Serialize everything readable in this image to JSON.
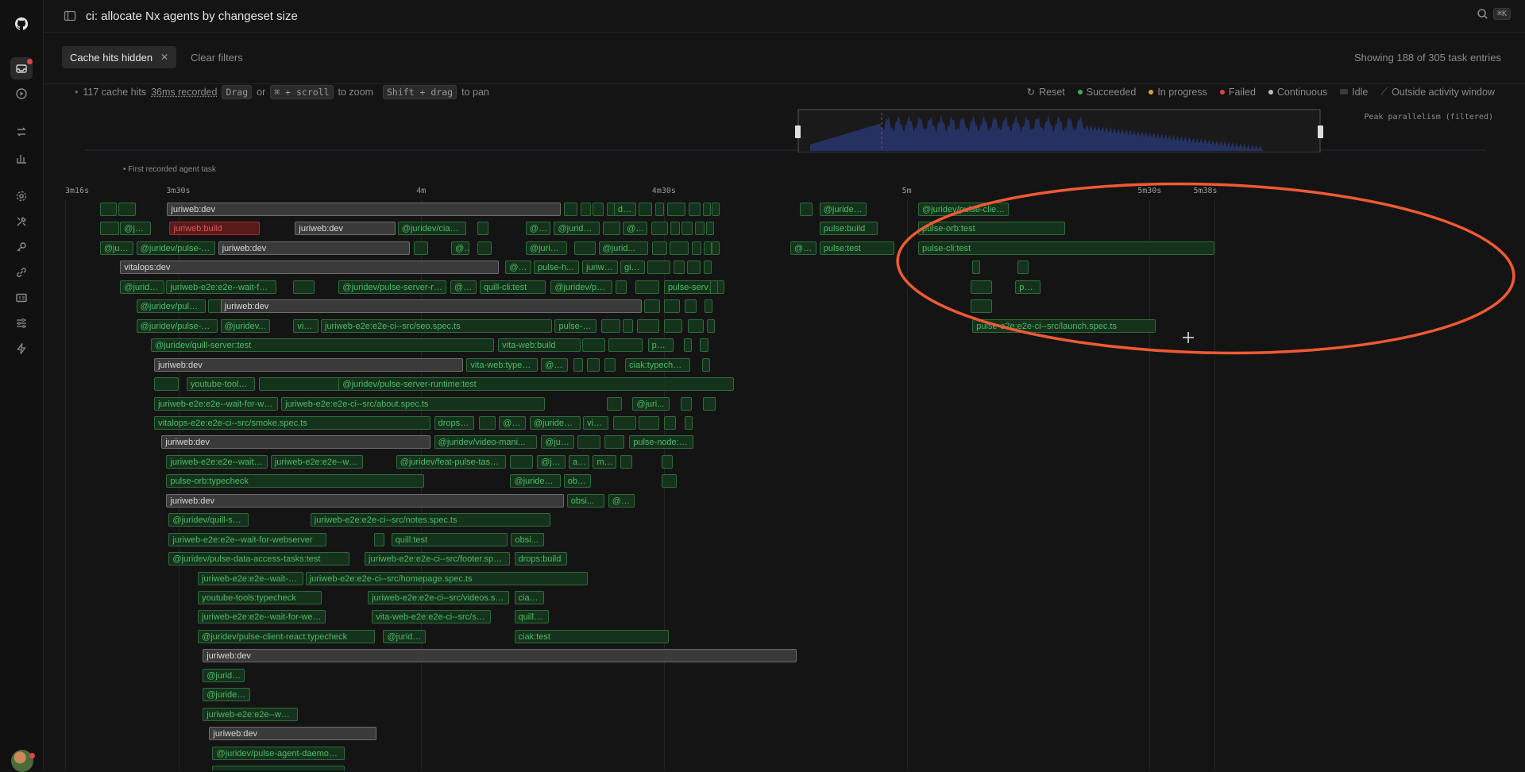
{
  "window": {
    "title": "ci: allocate Nx agents by changeset size",
    "search_shortcut": "⌘K"
  },
  "filters": {
    "chip_label": "Cache hits hidden",
    "clear_label": "Clear filters",
    "showing": "Showing 188 of 305 task entries"
  },
  "hint": {
    "cache_hits": "117 cache hits",
    "recorded": "36ms recorded",
    "drag": "Drag",
    "or": "or",
    "zoom_keys": "⌘ + scroll",
    "to_zoom": "to zoom",
    "pan_keys": "Shift + drag",
    "to_pan": "to pan"
  },
  "legend": {
    "reset": "Reset",
    "succeeded": "Succeeded",
    "in_progress": "In progress",
    "failed": "Failed",
    "continuous": "Continuous",
    "idle": "Idle",
    "outside": "Outside activity window",
    "colors": {
      "succeeded": "#3fae5a",
      "in_progress": "#d9a531",
      "failed": "#e0434b",
      "continuous": "#bdbdbd",
      "idle": "#3a3a3a"
    }
  },
  "minimap": {
    "peak_label": "Peak parallelism (filtered)"
  },
  "first_task_label": "• First recorded agent task",
  "axis": {
    "ticks": [
      {
        "label": "3m16s",
        "t": 196
      },
      {
        "label": "3m30s",
        "t": 210
      },
      {
        "label": "4m",
        "t": 240
      },
      {
        "label": "4m30s",
        "t": 270
      },
      {
        "label": "5m",
        "t": 300
      },
      {
        "label": "5m30s",
        "t": 330
      },
      {
        "label": "5m38s",
        "t": 338
      }
    ]
  },
  "gantt": {
    "rows": [
      [
        {
          "s": 200.3,
          "e": 202.4,
          "l": ""
        },
        {
          "s": 202.6,
          "e": 204.7,
          "l": ""
        },
        {
          "s": 208.6,
          "e": 257.2,
          "l": "juriweb:dev",
          "st": "c"
        },
        {
          "s": 257.6,
          "e": 259.3,
          "l": ""
        },
        {
          "s": 259.7,
          "e": 261.0,
          "l": ""
        },
        {
          "s": 261.2,
          "e": 262.5,
          "l": ""
        },
        {
          "s": 262.9,
          "e": 263.6,
          "l": ""
        },
        {
          "s": 263.8,
          "e": 266.6,
          "l": "dat..."
        },
        {
          "s": 266.9,
          "e": 268.5,
          "l": ""
        },
        {
          "s": 268.9,
          "e": 270.0,
          "l": ""
        },
        {
          "s": 270.4,
          "e": 272.6,
          "l": ""
        },
        {
          "s": 273.0,
          "e": 274.5,
          "l": ""
        },
        {
          "s": 274.8,
          "e": 275.7,
          "l": ""
        },
        {
          "s": 275.9,
          "e": 276.7,
          "l": ""
        },
        {
          "s": 286.8,
          "e": 288.3,
          "l": ""
        },
        {
          "s": 289.2,
          "e": 295.0,
          "l": "@juridev/p..."
        },
        {
          "s": 301.4,
          "e": 312.6,
          "l": "@juridev/pulse-client-..."
        }
      ],
      [
        {
          "s": 200.3,
          "e": 202.7,
          "l": ""
        },
        {
          "s": 202.8,
          "e": 206.6,
          "l": "@juri..."
        },
        {
          "s": 208.9,
          "e": 220.0,
          "l": "juriweb:build",
          "st": "f"
        },
        {
          "s": 224.4,
          "e": 236.8,
          "l": "juriweb:dev",
          "st": "c"
        },
        {
          "s": 237.1,
          "e": 245.6,
          "l": "@juridev/ciak-ff..."
        },
        {
          "s": 246.9,
          "e": 248.3,
          "l": ""
        },
        {
          "s": 252.9,
          "e": 256.0,
          "l": "@ju..."
        },
        {
          "s": 256.4,
          "e": 262.0,
          "l": "@juridev/..."
        },
        {
          "s": 262.4,
          "e": 264.6,
          "l": ""
        },
        {
          "s": 264.9,
          "e": 267.9,
          "l": "@j..."
        },
        {
          "s": 268.4,
          "e": 270.5,
          "l": ""
        },
        {
          "s": 270.8,
          "e": 272.0,
          "l": ""
        },
        {
          "s": 272.2,
          "e": 273.5,
          "l": ""
        },
        {
          "s": 273.8,
          "e": 275.0,
          "l": ""
        },
        {
          "s": 275.2,
          "e": 276.2,
          "l": ""
        },
        {
          "s": 289.2,
          "e": 296.4,
          "l": "pulse:build"
        },
        {
          "s": 301.4,
          "e": 319.6,
          "l": "pulse-orb:test"
        }
      ],
      [
        {
          "s": 200.3,
          "e": 204.4,
          "l": "@jur..."
        },
        {
          "s": 204.8,
          "e": 214.5,
          "l": "@juridev/pulse-ag..."
        },
        {
          "s": 214.9,
          "e": 238.6,
          "l": "juriweb:dev",
          "st": "c"
        },
        {
          "s": 239.1,
          "e": 240.8,
          "l": ""
        },
        {
          "s": 243.7,
          "e": 246.0,
          "l": "@j..."
        },
        {
          "s": 246.9,
          "e": 248.7,
          "l": ""
        },
        {
          "s": 252.9,
          "e": 258.0,
          "l": "@juride..."
        },
        {
          "s": 258.9,
          "e": 261.6,
          "l": ""
        },
        {
          "s": 261.9,
          "e": 268.0,
          "l": "@jurid..."
        },
        {
          "s": 268.5,
          "e": 270.4,
          "l": ""
        },
        {
          "s": 270.7,
          "e": 273.0,
          "l": ""
        },
        {
          "s": 273.4,
          "e": 274.6,
          "l": ""
        },
        {
          "s": 274.9,
          "e": 275.7,
          "l": ""
        },
        {
          "s": 275.9,
          "e": 276.9,
          "l": ""
        },
        {
          "s": 285.6,
          "e": 288.8,
          "l": "@ju..."
        },
        {
          "s": 289.2,
          "e": 298.5,
          "l": "pulse:test"
        },
        {
          "s": 301.4,
          "e": 338.0,
          "l": "pulse-cli:test"
        }
      ],
      [
        {
          "s": 202.8,
          "e": 249.6,
          "l": "vitalops:dev",
          "st": "c"
        },
        {
          "s": 250.4,
          "e": 253.6,
          "l": "@ju..."
        },
        {
          "s": 253.9,
          "e": 259.5,
          "l": "pulse-h..."
        },
        {
          "s": 259.9,
          "e": 264.3,
          "l": "juriwe..."
        },
        {
          "s": 264.6,
          "e": 267.6,
          "l": "gira..."
        },
        {
          "s": 267.9,
          "e": 270.8,
          "l": ""
        },
        {
          "s": 271.2,
          "e": 272.5,
          "l": ""
        },
        {
          "s": 272.8,
          "e": 274.5,
          "l": ""
        },
        {
          "s": 274.9,
          "e": 275.8,
          "l": ""
        },
        {
          "s": 308.1,
          "e": 309.0,
          "l": ""
        },
        {
          "s": 313.7,
          "e": 315.0,
          "l": ""
        }
      ],
      [
        {
          "s": 202.8,
          "e": 208.3,
          "l": "@juridev/..."
        },
        {
          "s": 208.5,
          "e": 222.1,
          "l": "juriweb-e2e:e2e--wait-for-..."
        },
        {
          "s": 224.2,
          "e": 226.8,
          "l": ""
        },
        {
          "s": 229.8,
          "e": 243.1,
          "l": "@juridev/pulse-server-runtim..."
        },
        {
          "s": 243.6,
          "e": 246.8,
          "l": "@jur..."
        },
        {
          "s": 247.2,
          "e": 255.4,
          "l": "quill-cli:test"
        },
        {
          "s": 256.0,
          "e": 263.6,
          "l": "@juridev/pulse..."
        },
        {
          "s": 264.0,
          "e": 265.4,
          "l": ""
        },
        {
          "s": 266.5,
          "e": 269.4,
          "l": ""
        },
        {
          "s": 270.0,
          "e": 277.5,
          "l": "pulse-server:..."
        },
        {
          "s": 275.7,
          "e": 276.7,
          "l": ""
        },
        {
          "s": 307.9,
          "e": 310.5,
          "l": ""
        },
        {
          "s": 313.4,
          "e": 316.5,
          "l": "pul..."
        }
      ],
      [
        {
          "s": 204.8,
          "e": 213.4,
          "l": "@juridev/pulse-cr..."
        },
        {
          "s": 213.7,
          "e": 223.6,
          "l": ""
        },
        {
          "s": 215.2,
          "e": 267.2,
          "l": "juriweb:dev",
          "st": "c"
        },
        {
          "s": 267.5,
          "e": 269.5,
          "l": ""
        },
        {
          "s": 270.0,
          "e": 272.0,
          "l": ""
        },
        {
          "s": 272.5,
          "e": 274.0,
          "l": ""
        },
        {
          "s": 275.0,
          "e": 276.0,
          "l": ""
        },
        {
          "s": 307.9,
          "e": 310.5,
          "l": ""
        }
      ],
      [
        {
          "s": 204.8,
          "e": 214.8,
          "l": "@juridev/pulse-code..."
        },
        {
          "s": 215.2,
          "e": 221.3,
          "l": "@juridev..."
        },
        {
          "s": 224.2,
          "e": 227.3,
          "l": "vita..."
        },
        {
          "s": 227.6,
          "e": 256.2,
          "l": "juriweb-e2e:e2e-ci--src/seo.spec.ts"
        },
        {
          "s": 256.5,
          "e": 261.7,
          "l": "pulse-e..."
        },
        {
          "s": 262.2,
          "e": 264.6,
          "l": ""
        },
        {
          "s": 264.9,
          "e": 266.2,
          "l": ""
        },
        {
          "s": 266.7,
          "e": 269.4,
          "l": ""
        },
        {
          "s": 270.0,
          "e": 272.3,
          "l": ""
        },
        {
          "s": 272.9,
          "e": 274.9,
          "l": ""
        },
        {
          "s": 275.3,
          "e": 276.2,
          "l": ""
        },
        {
          "s": 308.1,
          "e": 330.7,
          "l": "pulse-e2e:e2e-ci--src/launch.spec.ts"
        }
      ],
      [
        {
          "s": 206.6,
          "e": 249.0,
          "l": "@juridev/quill-server:test"
        },
        {
          "s": 249.5,
          "e": 259.7,
          "l": "vita-web:build"
        },
        {
          "s": 259.9,
          "e": 262.7,
          "l": ""
        },
        {
          "s": 263.1,
          "e": 267.3,
          "l": ""
        },
        {
          "s": 268.0,
          "e": 271.2,
          "l": "pul..."
        },
        {
          "s": 272.4,
          "e": 273.4,
          "l": ""
        },
        {
          "s": 274.4,
          "e": 275.5,
          "l": ""
        }
      ],
      [
        {
          "s": 207.0,
          "e": 245.2,
          "l": "juriweb:dev",
          "st": "c"
        },
        {
          "s": 245.6,
          "e": 254.4,
          "l": "vita-web:typech..."
        },
        {
          "s": 254.8,
          "e": 258.1,
          "l": "@ju..."
        },
        {
          "s": 258.8,
          "e": 260.0,
          "l": ""
        },
        {
          "s": 260.5,
          "e": 262.0,
          "l": ""
        },
        {
          "s": 262.6,
          "e": 264.0,
          "l": ""
        },
        {
          "s": 265.2,
          "e": 273.2,
          "l": "ciak:typecheck"
        },
        {
          "s": 274.7,
          "e": 275.7,
          "l": ""
        }
      ],
      [
        {
          "s": 207.0,
          "e": 210.0,
          "l": ""
        },
        {
          "s": 211.0,
          "e": 219.5,
          "l": "youtube-tools:build"
        },
        {
          "s": 219.9,
          "e": 230.3,
          "l": ""
        },
        {
          "s": 229.8,
          "e": 278.6,
          "l": "@juridev/pulse-server-runtime:test"
        }
      ],
      [
        {
          "s": 207.0,
          "e": 222.3,
          "l": "juriweb-e2e:e2e--wait-for-webs..."
        },
        {
          "s": 222.7,
          "e": 255.3,
          "l": "juriweb-e2e:e2e-ci--src/about.spec.ts"
        },
        {
          "s": 262.9,
          "e": 264.8,
          "l": ""
        },
        {
          "s": 266.1,
          "e": 270.7,
          "l": "@juri..."
        },
        {
          "s": 272.1,
          "e": 273.4,
          "l": ""
        },
        {
          "s": 274.8,
          "e": 276.4,
          "l": ""
        }
      ],
      [
        {
          "s": 207.0,
          "e": 241.1,
          "l": "vitalops-e2e:e2e-ci--src/smoke.spec.ts"
        },
        {
          "s": 241.6,
          "e": 246.5,
          "l": "drops:t..."
        },
        {
          "s": 247.1,
          "e": 249.2,
          "l": ""
        },
        {
          "s": 249.6,
          "e": 252.9,
          "l": "@jur..."
        },
        {
          "s": 253.4,
          "e": 259.7,
          "l": "@juridev/fe..."
        },
        {
          "s": 260.0,
          "e": 263.1,
          "l": "vita..."
        },
        {
          "s": 263.7,
          "e": 266.6,
          "l": ""
        },
        {
          "s": 266.9,
          "e": 269.4,
          "l": ""
        },
        {
          "s": 270.0,
          "e": 271.5,
          "l": ""
        },
        {
          "s": 272.5,
          "e": 273.5,
          "l": ""
        }
      ],
      [
        {
          "s": 207.9,
          "e": 241.1,
          "l": "juriweb:dev",
          "st": "c"
        },
        {
          "s": 241.6,
          "e": 254.3,
          "l": "@juridev/video-mani..."
        },
        {
          "s": 254.8,
          "e": 258.9,
          "l": "@jurid..."
        },
        {
          "s": 259.3,
          "e": 262.1,
          "l": ""
        },
        {
          "s": 262.6,
          "e": 265.1,
          "l": ""
        },
        {
          "s": 265.7,
          "e": 273.6,
          "l": "pulse-node:ty..."
        }
      ],
      [
        {
          "s": 208.5,
          "e": 221.0,
          "l": "juriweb-e2e:e2e--wait-for-..."
        },
        {
          "s": 221.4,
          "e": 232.8,
          "l": "juriweb-e2e:e2e--wai..."
        },
        {
          "s": 236.9,
          "e": 250.5,
          "l": "@juridev/feat-pulse-tasks:..."
        },
        {
          "s": 251.0,
          "e": 253.8,
          "l": ""
        },
        {
          "s": 254.3,
          "e": 257.8,
          "l": "@jur..."
        },
        {
          "s": 258.2,
          "e": 260.8,
          "l": "au..."
        },
        {
          "s": 261.2,
          "e": 264.1,
          "l": "me..."
        },
        {
          "s": 264.6,
          "e": 266.1,
          "l": ""
        },
        {
          "s": 269.7,
          "e": 271.1,
          "l": ""
        }
      ],
      [
        {
          "s": 208.5,
          "e": 240.4,
          "l": "pulse-orb:typecheck"
        },
        {
          "s": 251.0,
          "e": 257.2,
          "l": "@juridev/..."
        },
        {
          "s": 257.6,
          "e": 261.0,
          "l": "obsi..."
        },
        {
          "s": 269.7,
          "e": 271.6,
          "l": ""
        }
      ],
      [
        {
          "s": 208.5,
          "e": 257.6,
          "l": "juriweb:dev",
          "st": "c"
        },
        {
          "s": 258.0,
          "e": 262.6,
          "l": "obsi..."
        },
        {
          "s": 263.1,
          "e": 266.4,
          "l": "@jur..."
        }
      ],
      [
        {
          "s": 208.8,
          "e": 218.7,
          "l": "@juridev/quill-serv..."
        },
        {
          "s": 226.3,
          "e": 256.0,
          "l": "juriweb-e2e:e2e-ci--src/notes.spec.ts"
        }
      ],
      [
        {
          "s": 208.8,
          "e": 228.3,
          "l": "juriweb-e2e:e2e--wait-for-webserver"
        },
        {
          "s": 234.2,
          "e": 235.5,
          "l": ""
        },
        {
          "s": 236.3,
          "e": 250.7,
          "l": "quill:test"
        },
        {
          "s": 251.1,
          "e": 255.2,
          "l": "obsi..."
        }
      ],
      [
        {
          "s": 208.8,
          "e": 231.1,
          "l": "@juridev/pulse-data-access-tasks:test"
        },
        {
          "s": 233.0,
          "e": 251.0,
          "l": "juriweb-e2e:e2e-ci--src/footer.spec.ts"
        },
        {
          "s": 251.5,
          "e": 258.0,
          "l": "drops:build"
        }
      ],
      [
        {
          "s": 212.4,
          "e": 225.4,
          "l": "juriweb-e2e:e2e--wait-for-..."
        },
        {
          "s": 225.7,
          "e": 260.6,
          "l": "juriweb-e2e:e2e-ci--src/homepage.spec.ts"
        }
      ],
      [
        {
          "s": 212.4,
          "e": 227.7,
          "l": "youtube-tools:typecheck"
        },
        {
          "s": 233.4,
          "e": 250.9,
          "l": "juriweb-e2e:e2e-ci--src/videos.spec.ts"
        },
        {
          "s": 251.5,
          "e": 255.2,
          "l": "ciak..."
        }
      ],
      [
        {
          "s": 212.4,
          "e": 228.2,
          "l": "juriweb-e2e:e2e--wait-for-webserver"
        },
        {
          "s": 233.9,
          "e": 248.6,
          "l": "vita-web-e2e:e2e-ci--src/sm..."
        },
        {
          "s": 251.5,
          "e": 255.8,
          "l": "quill-c..."
        }
      ],
      [
        {
          "s": 212.4,
          "e": 234.3,
          "l": "@juridev/pulse-client-react:typecheck"
        },
        {
          "s": 235.3,
          "e": 240.6,
          "l": "@juridev/..."
        },
        {
          "s": 251.5,
          "e": 270.6,
          "l": "ciak:test"
        }
      ],
      [
        {
          "s": 213.0,
          "e": 286.4,
          "l": "juriweb:dev",
          "st": "c"
        }
      ],
      [
        {
          "s": 213.0,
          "e": 218.2,
          "l": "@juridev..."
        }
      ],
      [
        {
          "s": 213.0,
          "e": 218.9,
          "l": "@juridev/..."
        }
      ],
      [
        {
          "s": 213.0,
          "e": 224.8,
          "l": "juriweb-e2e:e2e--wait-..."
        }
      ],
      [
        {
          "s": 213.8,
          "e": 234.5,
          "l": "juriweb:dev",
          "st": "c"
        }
      ],
      [
        {
          "s": 214.2,
          "e": 230.5,
          "l": "@juridev/pulse-agent-daemon:test"
        }
      ],
      [
        {
          "s": 214.2,
          "e": 230.5,
          "l": ""
        }
      ]
    ]
  }
}
